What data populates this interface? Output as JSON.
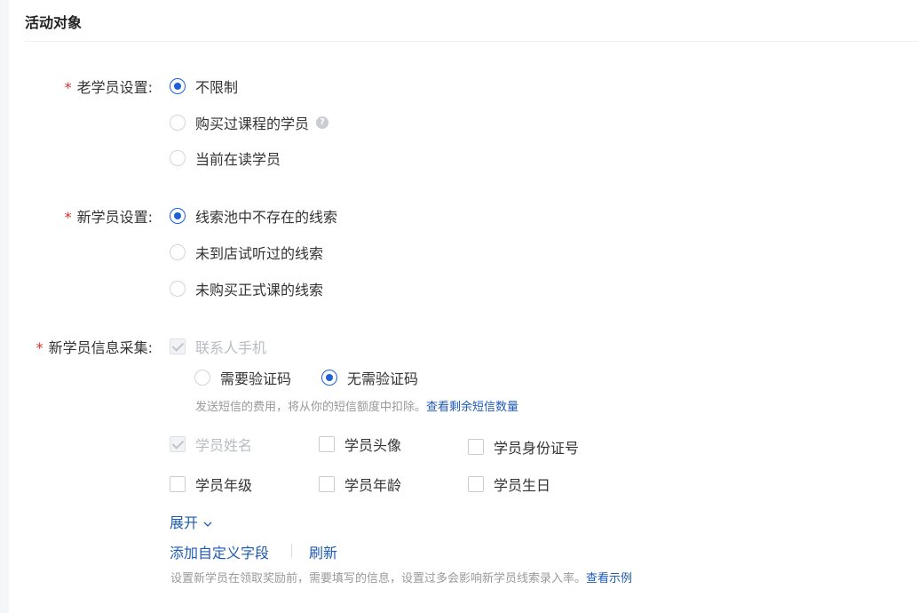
{
  "section": {
    "title": "活动对象"
  },
  "old_students": {
    "label": "老学员设置:",
    "required_mark": "*",
    "options": [
      {
        "label": "不限制",
        "checked": true
      },
      {
        "label": "购买过课程的学员",
        "checked": false,
        "help_icon": "question-circle-icon",
        "help_glyph": "?"
      },
      {
        "label": "当前在读学员",
        "checked": false
      }
    ]
  },
  "new_students": {
    "label": "新学员设置:",
    "required_mark": "*",
    "options": [
      {
        "label": "线索池中不存在的线索",
        "checked": true
      },
      {
        "label": "未到店试听过的线索",
        "checked": false
      },
      {
        "label": "未购买正式课的线索",
        "checked": false
      }
    ]
  },
  "info_collect": {
    "label": "新学员信息采集:",
    "required_mark": "*",
    "contact_phone": {
      "label": "联系人手机",
      "checked": true,
      "disabled": true
    },
    "verify_options": [
      {
        "label": "需要验证码",
        "checked": false
      },
      {
        "label": "无需验证码",
        "checked": true
      }
    ],
    "sms_hint": "发送短信的费用，将从你的短信额度中扣除。",
    "sms_link": "查看剩余短信数量",
    "fields": [
      {
        "label": "学员姓名",
        "checked": true,
        "disabled": true
      },
      {
        "label": "学员头像",
        "checked": false
      },
      {
        "label": "学员身份证号",
        "checked": false
      },
      {
        "label": "学员年级",
        "checked": false
      },
      {
        "label": "学员年龄",
        "checked": false
      },
      {
        "label": "学员生日",
        "checked": false
      }
    ],
    "expand_label": "展开",
    "expand_icon": "chevron-down-icon",
    "add_field_label": "添加自定义字段",
    "refresh_label": "刷新",
    "bottom_hint": "设置新学员在领取奖励前，需要填写的信息，设置过多会影响新学员线索录入率。",
    "example_link": "查看示例"
  },
  "colors": {
    "accent": "#1e61d4",
    "link": "#1e5ab8",
    "required": "#e02b2b"
  }
}
